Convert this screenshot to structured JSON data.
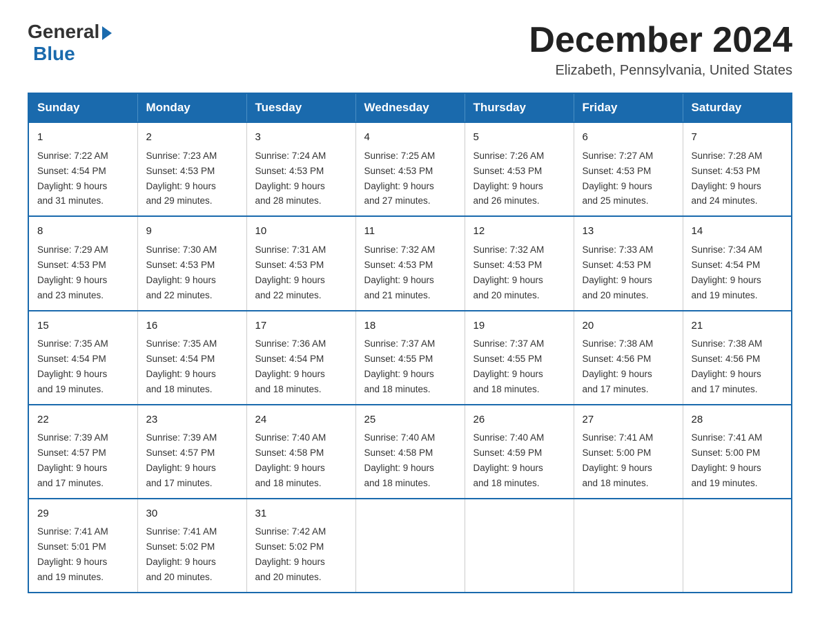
{
  "logo": {
    "general": "General",
    "blue": "Blue"
  },
  "title": "December 2024",
  "location": "Elizabeth, Pennsylvania, United States",
  "days_of_week": [
    "Sunday",
    "Monday",
    "Tuesday",
    "Wednesday",
    "Thursday",
    "Friday",
    "Saturday"
  ],
  "weeks": [
    [
      {
        "day": "1",
        "sunrise": "7:22 AM",
        "sunset": "4:54 PM",
        "daylight": "9 hours and 31 minutes."
      },
      {
        "day": "2",
        "sunrise": "7:23 AM",
        "sunset": "4:53 PM",
        "daylight": "9 hours and 29 minutes."
      },
      {
        "day": "3",
        "sunrise": "7:24 AM",
        "sunset": "4:53 PM",
        "daylight": "9 hours and 28 minutes."
      },
      {
        "day": "4",
        "sunrise": "7:25 AM",
        "sunset": "4:53 PM",
        "daylight": "9 hours and 27 minutes."
      },
      {
        "day": "5",
        "sunrise": "7:26 AM",
        "sunset": "4:53 PM",
        "daylight": "9 hours and 26 minutes."
      },
      {
        "day": "6",
        "sunrise": "7:27 AM",
        "sunset": "4:53 PM",
        "daylight": "9 hours and 25 minutes."
      },
      {
        "day": "7",
        "sunrise": "7:28 AM",
        "sunset": "4:53 PM",
        "daylight": "9 hours and 24 minutes."
      }
    ],
    [
      {
        "day": "8",
        "sunrise": "7:29 AM",
        "sunset": "4:53 PM",
        "daylight": "9 hours and 23 minutes."
      },
      {
        "day": "9",
        "sunrise": "7:30 AM",
        "sunset": "4:53 PM",
        "daylight": "9 hours and 22 minutes."
      },
      {
        "day": "10",
        "sunrise": "7:31 AM",
        "sunset": "4:53 PM",
        "daylight": "9 hours and 22 minutes."
      },
      {
        "day": "11",
        "sunrise": "7:32 AM",
        "sunset": "4:53 PM",
        "daylight": "9 hours and 21 minutes."
      },
      {
        "day": "12",
        "sunrise": "7:32 AM",
        "sunset": "4:53 PM",
        "daylight": "9 hours and 20 minutes."
      },
      {
        "day": "13",
        "sunrise": "7:33 AM",
        "sunset": "4:53 PM",
        "daylight": "9 hours and 20 minutes."
      },
      {
        "day": "14",
        "sunrise": "7:34 AM",
        "sunset": "4:54 PM",
        "daylight": "9 hours and 19 minutes."
      }
    ],
    [
      {
        "day": "15",
        "sunrise": "7:35 AM",
        "sunset": "4:54 PM",
        "daylight": "9 hours and 19 minutes."
      },
      {
        "day": "16",
        "sunrise": "7:35 AM",
        "sunset": "4:54 PM",
        "daylight": "9 hours and 18 minutes."
      },
      {
        "day": "17",
        "sunrise": "7:36 AM",
        "sunset": "4:54 PM",
        "daylight": "9 hours and 18 minutes."
      },
      {
        "day": "18",
        "sunrise": "7:37 AM",
        "sunset": "4:55 PM",
        "daylight": "9 hours and 18 minutes."
      },
      {
        "day": "19",
        "sunrise": "7:37 AM",
        "sunset": "4:55 PM",
        "daylight": "9 hours and 18 minutes."
      },
      {
        "day": "20",
        "sunrise": "7:38 AM",
        "sunset": "4:56 PM",
        "daylight": "9 hours and 17 minutes."
      },
      {
        "day": "21",
        "sunrise": "7:38 AM",
        "sunset": "4:56 PM",
        "daylight": "9 hours and 17 minutes."
      }
    ],
    [
      {
        "day": "22",
        "sunrise": "7:39 AM",
        "sunset": "4:57 PM",
        "daylight": "9 hours and 17 minutes."
      },
      {
        "day": "23",
        "sunrise": "7:39 AM",
        "sunset": "4:57 PM",
        "daylight": "9 hours and 17 minutes."
      },
      {
        "day": "24",
        "sunrise": "7:40 AM",
        "sunset": "4:58 PM",
        "daylight": "9 hours and 18 minutes."
      },
      {
        "day": "25",
        "sunrise": "7:40 AM",
        "sunset": "4:58 PM",
        "daylight": "9 hours and 18 minutes."
      },
      {
        "day": "26",
        "sunrise": "7:40 AM",
        "sunset": "4:59 PM",
        "daylight": "9 hours and 18 minutes."
      },
      {
        "day": "27",
        "sunrise": "7:41 AM",
        "sunset": "5:00 PM",
        "daylight": "9 hours and 18 minutes."
      },
      {
        "day": "28",
        "sunrise": "7:41 AM",
        "sunset": "5:00 PM",
        "daylight": "9 hours and 19 minutes."
      }
    ],
    [
      {
        "day": "29",
        "sunrise": "7:41 AM",
        "sunset": "5:01 PM",
        "daylight": "9 hours and 19 minutes."
      },
      {
        "day": "30",
        "sunrise": "7:41 AM",
        "sunset": "5:02 PM",
        "daylight": "9 hours and 20 minutes."
      },
      {
        "day": "31",
        "sunrise": "7:42 AM",
        "sunset": "5:02 PM",
        "daylight": "9 hours and 20 minutes."
      },
      null,
      null,
      null,
      null
    ]
  ],
  "labels": {
    "sunrise": "Sunrise:",
    "sunset": "Sunset:",
    "daylight": "Daylight:"
  }
}
